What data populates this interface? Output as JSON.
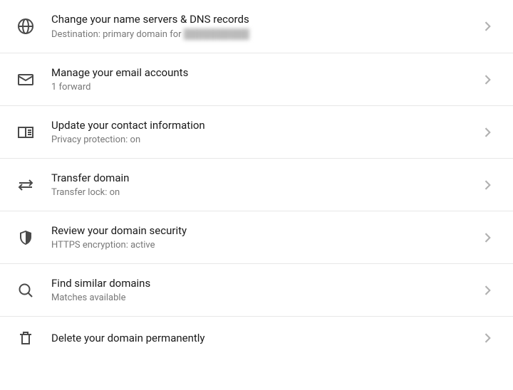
{
  "items": [
    {
      "icon": "globe-icon",
      "title": "Change your name servers & DNS records",
      "subtitle_prefix": "Destination: primary domain for ",
      "subtitle_obscured": "██████████"
    },
    {
      "icon": "mail-icon",
      "title": "Manage your email accounts",
      "subtitle": "1 forward"
    },
    {
      "icon": "contact-icon",
      "title": "Update your contact information",
      "subtitle": "Privacy protection: on"
    },
    {
      "icon": "transfer-icon",
      "title": "Transfer domain",
      "subtitle": "Transfer lock: on"
    },
    {
      "icon": "shield-icon",
      "title": "Review your domain security",
      "subtitle": "HTTPS encryption: active"
    },
    {
      "icon": "search-icon",
      "title": "Find similar domains",
      "subtitle": "Matches available"
    },
    {
      "icon": "trash-icon",
      "title": "Delete your domain permanently",
      "subtitle": ""
    }
  ]
}
